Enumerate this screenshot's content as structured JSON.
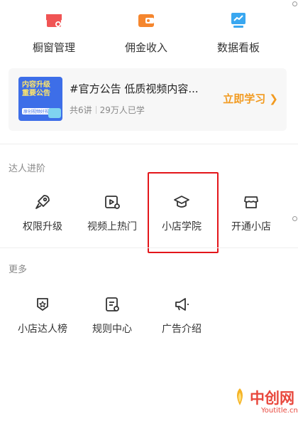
{
  "top_tools": [
    {
      "label": "橱窗管理",
      "icon": "shop-window-icon",
      "color": "#f05454"
    },
    {
      "label": "佣金收入",
      "icon": "wallet-icon",
      "color": "#f5862e"
    },
    {
      "label": "数据看板",
      "icon": "data-board-icon",
      "color": "#39a7f0"
    }
  ],
  "course": {
    "thumb_title_line1": "内容升级",
    "thumb_title_line2": "重要公告",
    "thumb_tag": "原创视频好视",
    "title": "#官方公告 低质视频内容...",
    "lessons": "共6讲",
    "learners": "29万人已学",
    "cta": "立即学习 ❯"
  },
  "advance": {
    "title": "达人进阶",
    "items": [
      {
        "label": "权限升级",
        "icon": "rocket-icon"
      },
      {
        "label": "视频上热门",
        "icon": "video-hot-icon"
      },
      {
        "label": "小店学院",
        "icon": "graduation-cap-icon"
      },
      {
        "label": "开通小店",
        "icon": "store-icon"
      }
    ]
  },
  "more": {
    "title": "更多",
    "items": [
      {
        "label": "小店达人榜",
        "icon": "badge-star-icon"
      },
      {
        "label": "规则中心",
        "icon": "rules-doc-icon"
      },
      {
        "label": "广告介绍",
        "icon": "megaphone-icon"
      }
    ]
  },
  "watermark": {
    "brand": "中创网",
    "sub": "Youtitle.cn",
    "handle": "·"
  },
  "colors": {
    "accent_orange": "#f29a1f",
    "highlight_red": "#e3161a",
    "thumb_blue": "#3d6ee8"
  }
}
